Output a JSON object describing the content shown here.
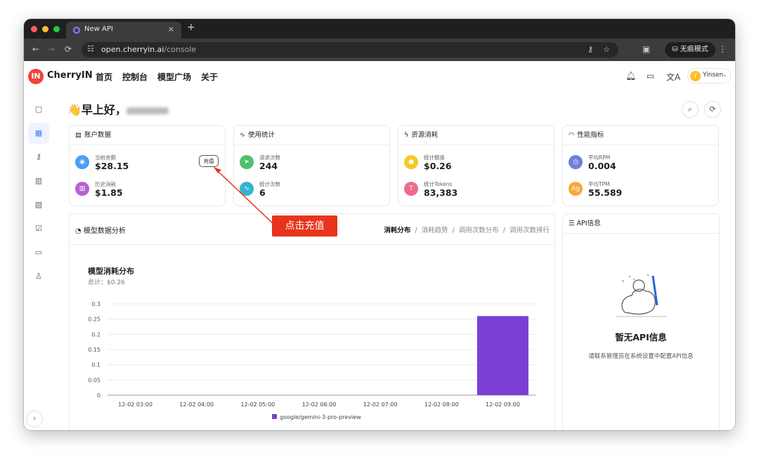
{
  "browser": {
    "tab_title": "New API",
    "tab_close": "×",
    "new_tab": "+",
    "url_host": "open.cherryin.ai",
    "url_path": "/console",
    "incognito_label": "无痕模式"
  },
  "header": {
    "logo_text": "IN",
    "brand": "CherryIN",
    "nav": [
      "首页",
      "控制台",
      "模型广场",
      "关于"
    ],
    "user_initial": "Y",
    "user_name": "Yinsen"
  },
  "greeting": "👋早上好，",
  "cards": {
    "account": {
      "title": "账户数据",
      "current_balance_label": "当前余额",
      "current_balance": "$28.15",
      "history_label": "历史消耗",
      "history_value": "$1.85",
      "recharge_label": "充值"
    },
    "usage": {
      "title": "使用统计",
      "requests_label": "请求次数",
      "requests_value": "244",
      "stat_count_label": "统计次数",
      "stat_count_value": "6"
    },
    "resource": {
      "title": "资源消耗",
      "quota_label": "统计额度",
      "quota_value": "$0.26",
      "tokens_label": "统计Tokens",
      "tokens_value": "83,383"
    },
    "performance": {
      "title": "性能指标",
      "rpm_label": "平均RPM",
      "rpm_value": "0.004",
      "tpm_label": "平均TPM",
      "tpm_value": "55.589"
    }
  },
  "analysis": {
    "title": "模型数据分析",
    "tabs": [
      "消耗分布",
      "消耗趋势",
      "调用次数分布",
      "调用次数排行"
    ],
    "tab_separator": "/",
    "chart_title": "模型消耗分布",
    "chart_total": "总计：$0.26"
  },
  "api_panel": {
    "title": "API信息",
    "empty_title": "暂无API信息",
    "empty_desc": "请联系管理员在系统设置中配置API信息"
  },
  "annotation": {
    "text": "点击充值"
  },
  "colors": {
    "bar": "#7b3fd6",
    "accent": "#3b82f6",
    "annotation": "#e8341c"
  },
  "chart_data": {
    "type": "bar",
    "categories": [
      "12-02 03:00",
      "12-02 04:00",
      "12-02 05:00",
      "12-02 06:00",
      "12-02 07:00",
      "12-02 08:00",
      "12-02 09:00"
    ],
    "series": [
      {
        "name": "google/gemini-3-pro-preview",
        "values": [
          0,
          0,
          0,
          0,
          0,
          0,
          0.26
        ]
      }
    ],
    "yticks": [
      "0",
      "0.05",
      "0.1",
      "0.15",
      "0.2",
      "0.25",
      "0.3"
    ],
    "ylim": [
      0,
      0.3
    ],
    "title": "模型消耗分布",
    "legend": "bottom-center",
    "grid": true
  }
}
